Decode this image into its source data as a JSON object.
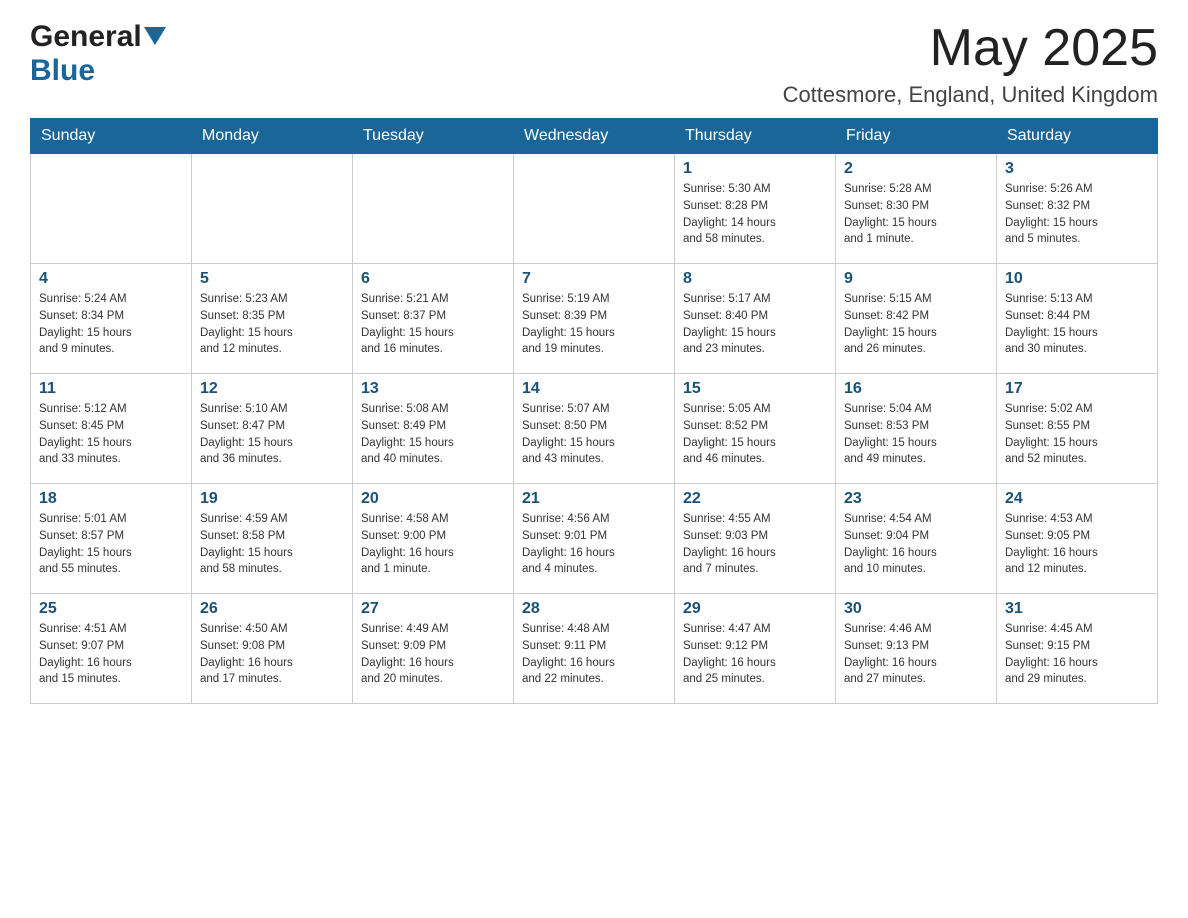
{
  "header": {
    "logo_general": "General",
    "logo_blue": "Blue",
    "month_title": "May 2025",
    "location": "Cottesmore, England, United Kingdom"
  },
  "days_of_week": [
    "Sunday",
    "Monday",
    "Tuesday",
    "Wednesday",
    "Thursday",
    "Friday",
    "Saturday"
  ],
  "weeks": [
    [
      {
        "day": "",
        "info": ""
      },
      {
        "day": "",
        "info": ""
      },
      {
        "day": "",
        "info": ""
      },
      {
        "day": "",
        "info": ""
      },
      {
        "day": "1",
        "info": "Sunrise: 5:30 AM\nSunset: 8:28 PM\nDaylight: 14 hours\nand 58 minutes."
      },
      {
        "day": "2",
        "info": "Sunrise: 5:28 AM\nSunset: 8:30 PM\nDaylight: 15 hours\nand 1 minute."
      },
      {
        "day": "3",
        "info": "Sunrise: 5:26 AM\nSunset: 8:32 PM\nDaylight: 15 hours\nand 5 minutes."
      }
    ],
    [
      {
        "day": "4",
        "info": "Sunrise: 5:24 AM\nSunset: 8:34 PM\nDaylight: 15 hours\nand 9 minutes."
      },
      {
        "day": "5",
        "info": "Sunrise: 5:23 AM\nSunset: 8:35 PM\nDaylight: 15 hours\nand 12 minutes."
      },
      {
        "day": "6",
        "info": "Sunrise: 5:21 AM\nSunset: 8:37 PM\nDaylight: 15 hours\nand 16 minutes."
      },
      {
        "day": "7",
        "info": "Sunrise: 5:19 AM\nSunset: 8:39 PM\nDaylight: 15 hours\nand 19 minutes."
      },
      {
        "day": "8",
        "info": "Sunrise: 5:17 AM\nSunset: 8:40 PM\nDaylight: 15 hours\nand 23 minutes."
      },
      {
        "day": "9",
        "info": "Sunrise: 5:15 AM\nSunset: 8:42 PM\nDaylight: 15 hours\nand 26 minutes."
      },
      {
        "day": "10",
        "info": "Sunrise: 5:13 AM\nSunset: 8:44 PM\nDaylight: 15 hours\nand 30 minutes."
      }
    ],
    [
      {
        "day": "11",
        "info": "Sunrise: 5:12 AM\nSunset: 8:45 PM\nDaylight: 15 hours\nand 33 minutes."
      },
      {
        "day": "12",
        "info": "Sunrise: 5:10 AM\nSunset: 8:47 PM\nDaylight: 15 hours\nand 36 minutes."
      },
      {
        "day": "13",
        "info": "Sunrise: 5:08 AM\nSunset: 8:49 PM\nDaylight: 15 hours\nand 40 minutes."
      },
      {
        "day": "14",
        "info": "Sunrise: 5:07 AM\nSunset: 8:50 PM\nDaylight: 15 hours\nand 43 minutes."
      },
      {
        "day": "15",
        "info": "Sunrise: 5:05 AM\nSunset: 8:52 PM\nDaylight: 15 hours\nand 46 minutes."
      },
      {
        "day": "16",
        "info": "Sunrise: 5:04 AM\nSunset: 8:53 PM\nDaylight: 15 hours\nand 49 minutes."
      },
      {
        "day": "17",
        "info": "Sunrise: 5:02 AM\nSunset: 8:55 PM\nDaylight: 15 hours\nand 52 minutes."
      }
    ],
    [
      {
        "day": "18",
        "info": "Sunrise: 5:01 AM\nSunset: 8:57 PM\nDaylight: 15 hours\nand 55 minutes."
      },
      {
        "day": "19",
        "info": "Sunrise: 4:59 AM\nSunset: 8:58 PM\nDaylight: 15 hours\nand 58 minutes."
      },
      {
        "day": "20",
        "info": "Sunrise: 4:58 AM\nSunset: 9:00 PM\nDaylight: 16 hours\nand 1 minute."
      },
      {
        "day": "21",
        "info": "Sunrise: 4:56 AM\nSunset: 9:01 PM\nDaylight: 16 hours\nand 4 minutes."
      },
      {
        "day": "22",
        "info": "Sunrise: 4:55 AM\nSunset: 9:03 PM\nDaylight: 16 hours\nand 7 minutes."
      },
      {
        "day": "23",
        "info": "Sunrise: 4:54 AM\nSunset: 9:04 PM\nDaylight: 16 hours\nand 10 minutes."
      },
      {
        "day": "24",
        "info": "Sunrise: 4:53 AM\nSunset: 9:05 PM\nDaylight: 16 hours\nand 12 minutes."
      }
    ],
    [
      {
        "day": "25",
        "info": "Sunrise: 4:51 AM\nSunset: 9:07 PM\nDaylight: 16 hours\nand 15 minutes."
      },
      {
        "day": "26",
        "info": "Sunrise: 4:50 AM\nSunset: 9:08 PM\nDaylight: 16 hours\nand 17 minutes."
      },
      {
        "day": "27",
        "info": "Sunrise: 4:49 AM\nSunset: 9:09 PM\nDaylight: 16 hours\nand 20 minutes."
      },
      {
        "day": "28",
        "info": "Sunrise: 4:48 AM\nSunset: 9:11 PM\nDaylight: 16 hours\nand 22 minutes."
      },
      {
        "day": "29",
        "info": "Sunrise: 4:47 AM\nSunset: 9:12 PM\nDaylight: 16 hours\nand 25 minutes."
      },
      {
        "day": "30",
        "info": "Sunrise: 4:46 AM\nSunset: 9:13 PM\nDaylight: 16 hours\nand 27 minutes."
      },
      {
        "day": "31",
        "info": "Sunrise: 4:45 AM\nSunset: 9:15 PM\nDaylight: 16 hours\nand 29 minutes."
      }
    ]
  ]
}
